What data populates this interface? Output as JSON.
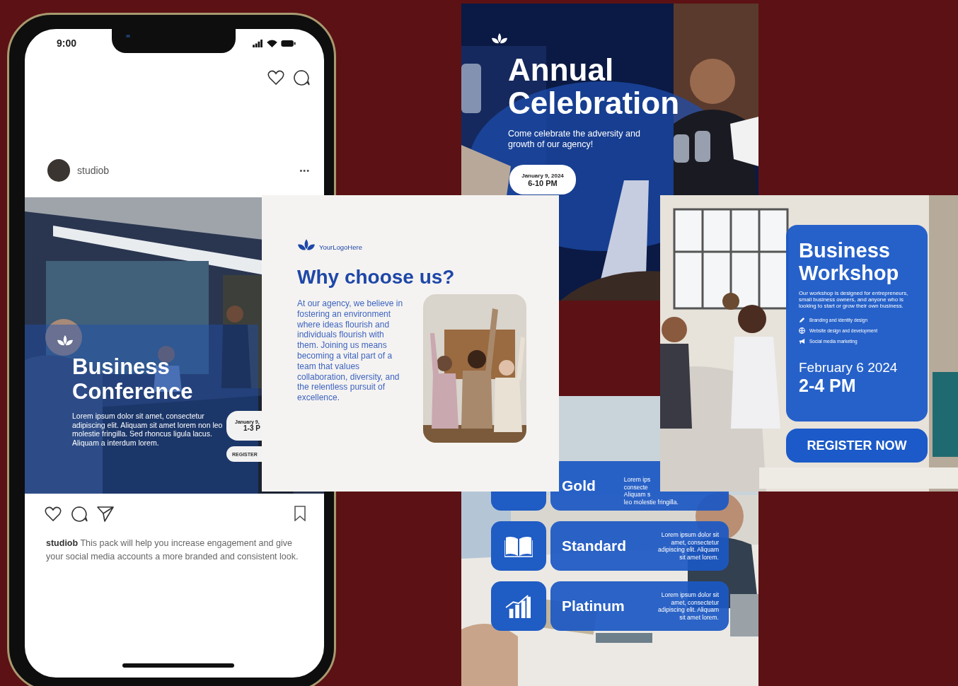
{
  "phone": {
    "status_bar": {
      "time": "9:00"
    },
    "post": {
      "username": "studiob",
      "more": "•••",
      "image": {
        "logo": true,
        "title": "Business Conference",
        "body": "Lorem ipsum dolor sit amet, consectetur adipiscing elit. Aliquam sit amet lorem non leo molestie fringilla. Sed rhoncus ligula lacus. Aliquam a interdum lorem.",
        "date": "January 9,",
        "time": "1-3 P",
        "button": "REGISTER"
      },
      "caption": {
        "username": "studiob",
        "text": "This pack will help you increase engagement and give your social media accounts a more branded and consistent look."
      }
    }
  },
  "annual_card": {
    "title": "Annual Celebration",
    "subtitle": "Come celebrate the adversity and growth of our agency!",
    "date": "January 9, 2024",
    "time": "6-10 PM"
  },
  "pricing_card": {
    "tiers": [
      {
        "name": "Gold",
        "description_lines": [
          "Lorem ips",
          "consecte",
          "Aliquam s",
          "leo molestie fringilla."
        ]
      },
      {
        "name": "Standard",
        "description_lines": [
          "Lorem ipsum dolor sit",
          "amet, consectetur",
          "adipiscing elit. Aliquam",
          "sit amet lorem."
        ]
      },
      {
        "name": "Platinum",
        "description_lines": [
          "Lorem ipsum dolor sit",
          "amet, consectetur",
          "adipiscing elit. Aliquam",
          "sit amet lorem."
        ]
      }
    ]
  },
  "why_card": {
    "logo": "YourLogoHere",
    "title": "Why choose us?",
    "body": "At our agency, we believe in fostering an environment where ideas flourish and individuals flourish with them. Joining us means becoming a vital part of a team that values collaboration, diversity, and the relentless pursuit of excellence."
  },
  "workshop_card": {
    "title": "Business Workshop",
    "body": "Our workshop is designed for entrepreneurs, small business owners, and anyone who is looking to start or grow their own business.",
    "features": [
      "Branding and identity design",
      "Website design and development",
      "Social media marketing"
    ],
    "date": "February 6 2024",
    "time": "2-4 PM",
    "button": "REGISTER NOW"
  }
}
